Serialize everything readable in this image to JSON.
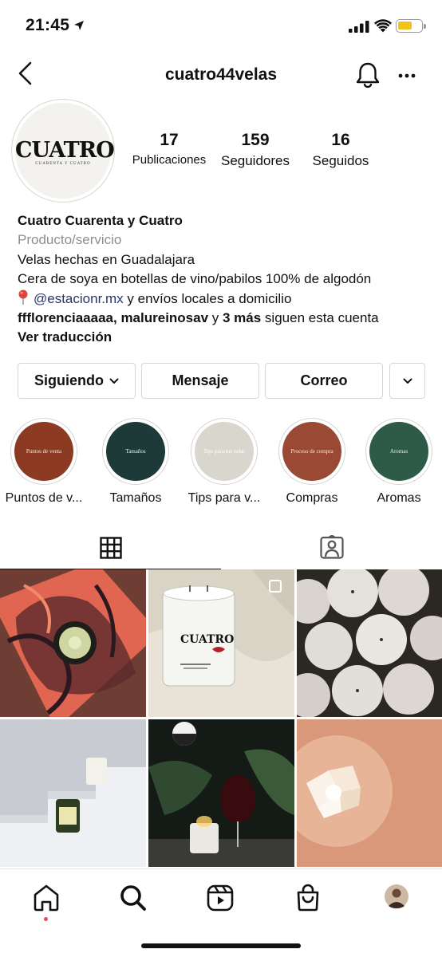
{
  "status_bar": {
    "time": "21:45"
  },
  "header": {
    "username": "cuatro44velas"
  },
  "profile": {
    "avatar_logo": "CUATRO",
    "avatar_sub": "CUARENTA Y CUATRO",
    "stats": [
      {
        "value": "17",
        "label": "Publicaciones"
      },
      {
        "value": "159",
        "label": "Seguidores"
      },
      {
        "value": "16",
        "label": "Seguidos"
      }
    ],
    "display_name": "Cuatro Cuarenta y Cuatro",
    "category": "Producto/servicio",
    "bio_line1": "Velas hechas en Guadalajara",
    "bio_line2": "Cera de soya en botellas de vino/pabilos 100% de algodón",
    "bio_mention": "@estacionr.mx",
    "bio_line3_rest": " y envíos locales a domicilio",
    "followed_by_users": "fffloren ciaaaaa, malureinosav",
    "followed_by_and": " y ",
    "followed_by_more": "3 más",
    "followed_by_suffix": " siguen esta cuenta",
    "translate": "Ver traducción"
  },
  "actions": {
    "following": "Siguiendo",
    "message": "Mensaje",
    "email": "Correo"
  },
  "highlights": [
    {
      "label": "Puntos de v...",
      "cover_text": "Puntos de venta",
      "color": "#8c3a22",
      "text_color": "#f3e6dc"
    },
    {
      "label": "Tamaños",
      "cover_text": "Tamaños",
      "color": "#1d3a39",
      "text_color": "#e8efe8"
    },
    {
      "label": "Tips para v...",
      "cover_text": "Tips para tus velas",
      "color": "#d8d6cd",
      "text_color": "#ffffff"
    },
    {
      "label": "Compras",
      "cover_text": "Proceso de compra",
      "color": "#9a4a34",
      "text_color": "#f3e6dc"
    },
    {
      "label": "Aromas",
      "cover_text": "Aromas",
      "color": "#2d5b47",
      "text_color": "#e8efe8"
    }
  ],
  "posts_tile_labels": {
    "candle_brand": "CUATRO"
  }
}
